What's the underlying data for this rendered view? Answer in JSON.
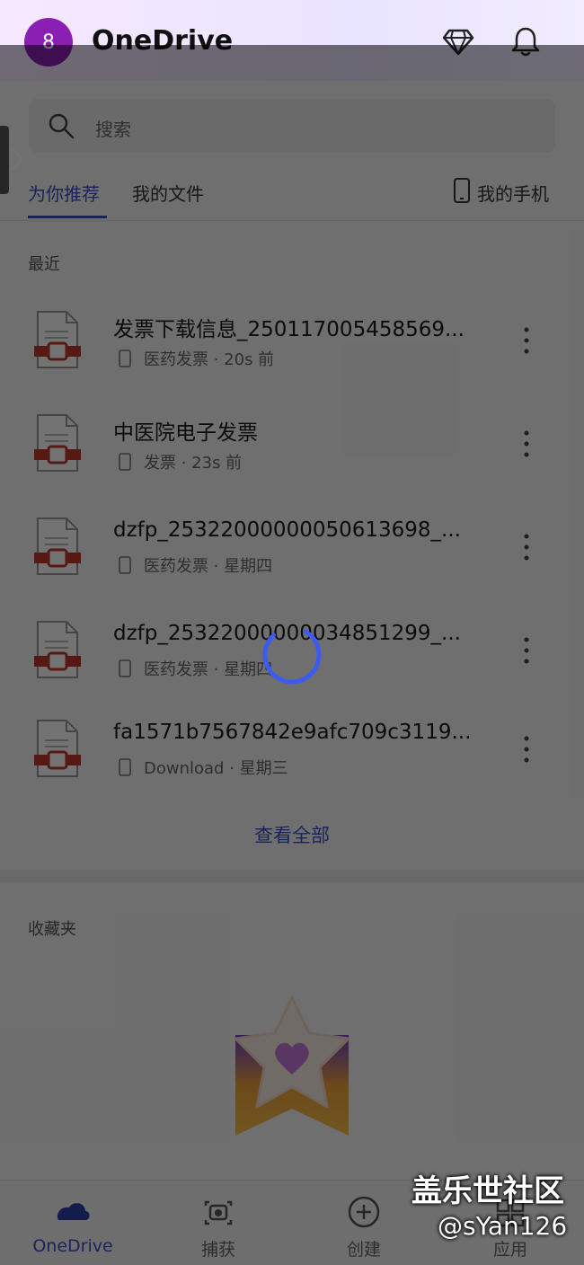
{
  "header": {
    "avatar_text": "8",
    "title": "OneDrive",
    "icons": [
      "diamond-icon",
      "bell-icon"
    ]
  },
  "search": {
    "placeholder": "搜索"
  },
  "tabs": [
    {
      "label": "为你推荐",
      "active": true
    },
    {
      "label": "我的文件",
      "active": false
    },
    {
      "label": "我的手机",
      "active": false
    }
  ],
  "recent": {
    "label": "最近",
    "files": [
      {
        "name": "发票下载信息_250117005458569...",
        "meta": "医药发票 · 20s 前"
      },
      {
        "name": "中医院电子发票",
        "meta": "发票 · 23s 前"
      },
      {
        "name": "dzfp_25322000000050613698_...",
        "meta": "医药发票 · 星期四"
      },
      {
        "name": "dzfp_25322000000034851299_...",
        "meta": "医药发票 · 星期四"
      },
      {
        "name": "fa1571b7567842e9afc709c3119...",
        "meta": "Download · 星期三"
      }
    ],
    "view_all": "查看全部"
  },
  "favorites": {
    "label": "收藏夹"
  },
  "bottom_nav": [
    {
      "label": "OneDrive",
      "icon": "cloud-icon",
      "active": true
    },
    {
      "label": "捕获",
      "icon": "camera-icon",
      "active": false
    },
    {
      "label": "创建",
      "icon": "plus-circle-icon",
      "active": false
    },
    {
      "label": "应用",
      "icon": "apps-icon",
      "active": false
    }
  ],
  "watermark": {
    "main": "盖乐世社区",
    "sub": "@sYan126"
  },
  "colors": {
    "accent": "#3d51c7",
    "avatar": "#8b1fb3",
    "file_icon_red": "#c0392b"
  }
}
